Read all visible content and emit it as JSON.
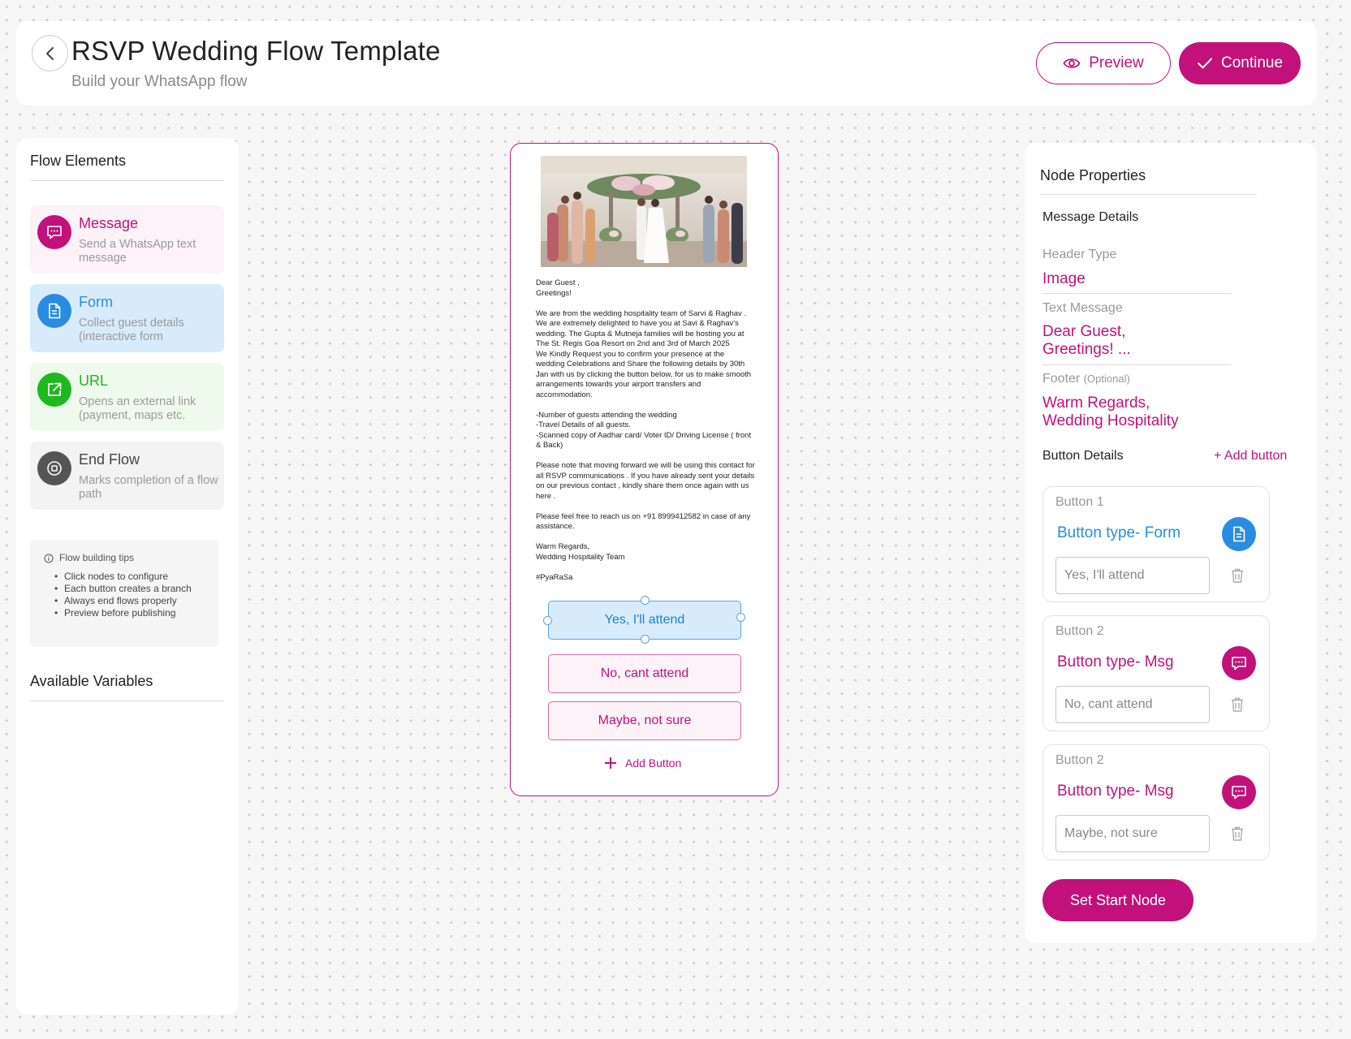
{
  "header": {
    "title": "RSVP Wedding Flow Template",
    "subtitle": "Build your WhatsApp flow",
    "preview_label": "Preview",
    "continue_label": "Continue"
  },
  "left_panel": {
    "heading": "Flow Elements",
    "elements": [
      {
        "title": "Message",
        "desc": "Send a WhatsApp text message",
        "color": "#c2117a",
        "bg": "#fdf2f7",
        "icon": "chat-icon"
      },
      {
        "title": "Form",
        "desc": "Collect guest details (interactive form",
        "color": "#2a8ce0",
        "bg": "#d8ebfb",
        "icon": "form-icon"
      },
      {
        "title": "URL",
        "desc": "Opens an external link (payment, maps etc.",
        "color": "#1fb81f",
        "bg": "#eefbec",
        "icon": "external-link-icon"
      },
      {
        "title": "End Flow",
        "desc": "Marks completion of a flow path",
        "color": "#555555",
        "bg": "#f3f3f3",
        "icon": "stop-icon"
      }
    ],
    "tips": {
      "title": "Flow building tips",
      "items": [
        "Click nodes to configure",
        "Each button creates a branch",
        "Always end flows properly",
        "Preview before publishing"
      ]
    },
    "variables_heading": "Available Variables"
  },
  "phone": {
    "message": "Dear Guest ,\nGreetings!\n\nWe are from the wedding hospitality team of Sarvi & Raghav .  We are extremely delighted to have you at Savi & Raghav's wedding. The Gupta & Mutneja families will be hosting you at The St. Regis Goa Resort on 2nd and 3rd of March 2025\nWe Kindly Request you to confirm your presence at the wedding Celebrations and Share the following details by 30th Jan with us by clicking the button below, for us to make smooth arrangements towards your airport transfers and accommodation.\n\n-Number of guests attending the wedding\n-Travel Details of all guests.\n-Scanned copy of Aadhar card/ Voter ID/ Driving License ( front & Back)\n\nPlease note that moving forward we will be using this contact for all RSVP communications . If you have already sent your details on our previous contact , kindly share them once again with us here .\n\nPlease feel free to reach us on +91 8999412582 in case of any assistance.\n\nWarm Regards,\nWedding Hospitality Team\n\n#PyaRaSa",
    "buttons": [
      "Yes, I'll attend",
      "No, cant attend",
      "Maybe, not sure"
    ],
    "add_button_label": "Add Button"
  },
  "node_properties": {
    "heading": "Node Properties",
    "message_details": "Message Details",
    "header_type_label": "Header Type",
    "header_type_value": "Image",
    "text_message_label": "Text Message",
    "text_message_line1": "Dear Guest,",
    "text_message_line2": "Greetings! ...",
    "footer_label": "Footer",
    "footer_optional": "(Optional)",
    "footer_line1": "Warm Regards,",
    "footer_line2": "Wedding Hospitality",
    "button_details": "Button Details",
    "add_button": "+ Add button",
    "buttons": [
      {
        "label": "Button 1",
        "type": "Button type- Form",
        "value": "Yes, I'll attend",
        "color": "#2a8ce0",
        "icon": "form-icon"
      },
      {
        "label": "Button 2",
        "type": "Button type- Msg",
        "value": "No, cant attend",
        "color": "#c2117a",
        "icon": "chat-icon"
      },
      {
        "label": "Button 2",
        "type": "Button type- Msg",
        "value": "Maybe, not sure",
        "color": "#c2117a",
        "icon": "chat-icon"
      }
    ],
    "set_start_node": "Set Start Node"
  },
  "colors": {
    "brand": "#c2117a",
    "form_blue": "#2a8ce0",
    "url_green": "#1fb81f"
  }
}
